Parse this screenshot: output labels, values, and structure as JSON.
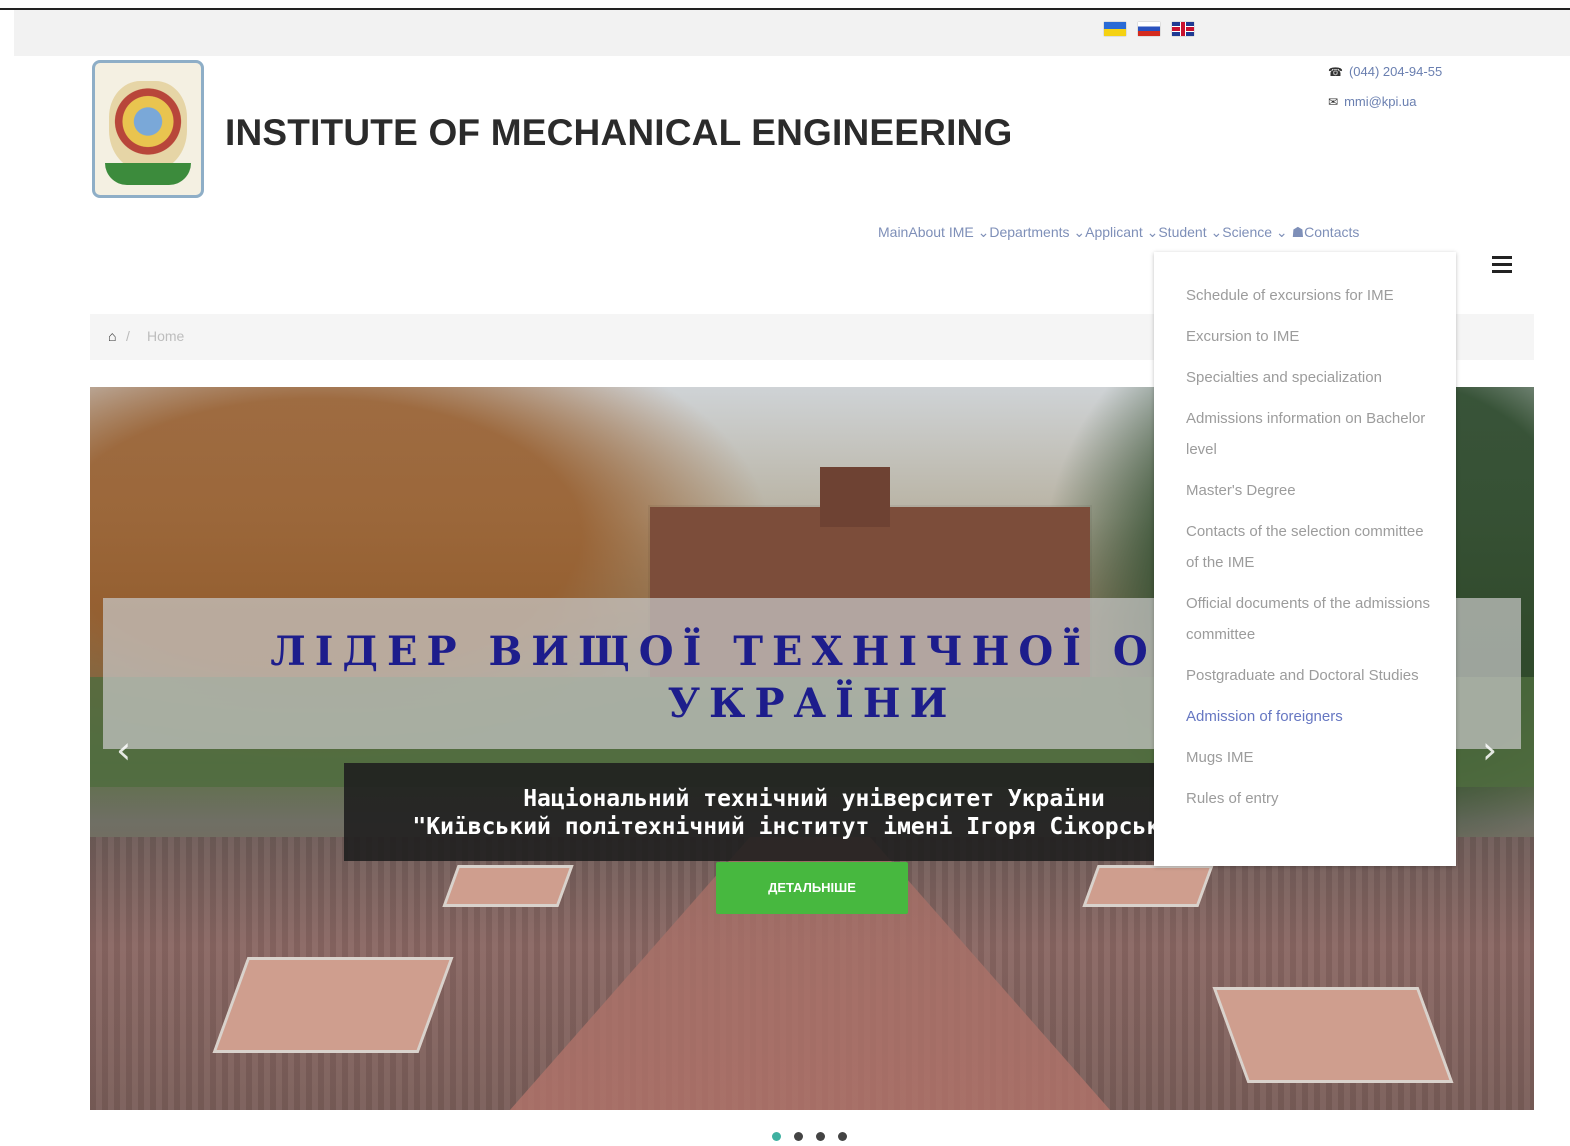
{
  "header": {
    "title": "INSTITUTE OF MECHANICAL ENGINEERING",
    "phone": "(044) 204-94-55",
    "email": "mmi@kpi.ua",
    "flags": [
      "ua-flag-icon",
      "ru-flag-icon",
      "en-flag-icon"
    ]
  },
  "nav": {
    "main": "Main",
    "about": "About IME ⌄",
    "departments": "Departments ⌄",
    "applicant": "Applicant ⌄",
    "student": "Student ⌄",
    "science": "Science ⌄",
    "contacts": "Contacts"
  },
  "breadcrumb": {
    "home": "Home"
  },
  "hero": {
    "title_line1": "ЛІДЕР ВИЩОЇ ТЕХНІЧНОЇ ОСВІТИ",
    "title_line2": "УКРАЇНИ",
    "subtitle_line1": "Національний технічний університет України",
    "subtitle_line2": "\"Київський політехнічний інститут імені Ігоря Сікорського\"",
    "button": "ДЕТАЛЬНІШЕ",
    "prev": "‹",
    "next": "›"
  },
  "dropdown": {
    "items": [
      "Schedule of excursions for IME",
      "Excursion to IME",
      "Specialties and specialization",
      "Admissions information on Bachelor level",
      "Master's Degree",
      "Contacts of the selection committee of the IME",
      "Official documents of the admissions committee",
      "Postgraduate and Doctoral Studies",
      "Admission of foreigners",
      "Mugs IME",
      "Rules of entry"
    ],
    "active_index": 8
  },
  "slider": {
    "slides": 4,
    "active": 1
  },
  "colors": {
    "accent": "#47b83f",
    "link": "#6677c2",
    "title": "#1d1d8c"
  }
}
